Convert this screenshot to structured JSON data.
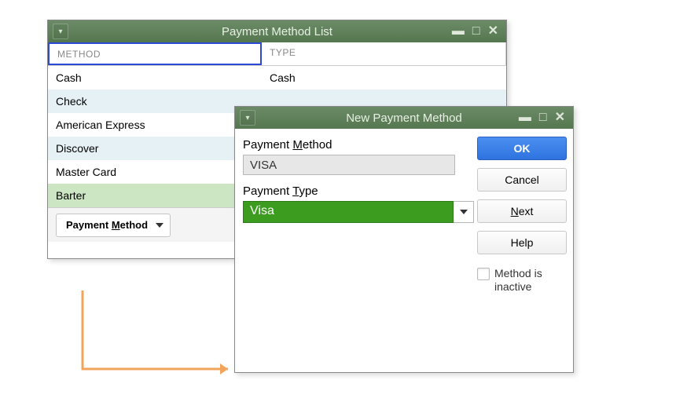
{
  "listWindow": {
    "title": "Payment Method List",
    "headers": {
      "method": "METHOD",
      "type": "TYPE"
    },
    "rows": [
      {
        "method": "Cash",
        "type": "Cash",
        "alt": 0
      },
      {
        "method": "Check",
        "type": "",
        "alt": 1
      },
      {
        "method": "American Express",
        "type": "",
        "alt": 0
      },
      {
        "method": "Discover",
        "type": "",
        "alt": 1
      },
      {
        "method": "Master Card",
        "type": "",
        "alt": 0
      },
      {
        "method": "Barter",
        "type": "",
        "alt": "sel"
      }
    ],
    "footerButton": {
      "pre": "Payment ",
      "acc": "M",
      "post": "ethod"
    }
  },
  "modal": {
    "title": "New Payment Method",
    "fields": {
      "paymentMethod": {
        "labelPre": "Payment ",
        "labelAcc": "M",
        "labelPost": "ethod",
        "value": "VISA"
      },
      "paymentType": {
        "labelPre": "Payment ",
        "labelAcc": "T",
        "labelPost": "ype",
        "value": "Visa"
      }
    },
    "buttons": {
      "ok": "OK",
      "cancel": "Cancel",
      "nextPre": "",
      "nextAcc": "N",
      "nextPost": "ext",
      "help": "Help"
    },
    "checkbox": {
      "label": "Method is inactive",
      "checked": false
    }
  }
}
